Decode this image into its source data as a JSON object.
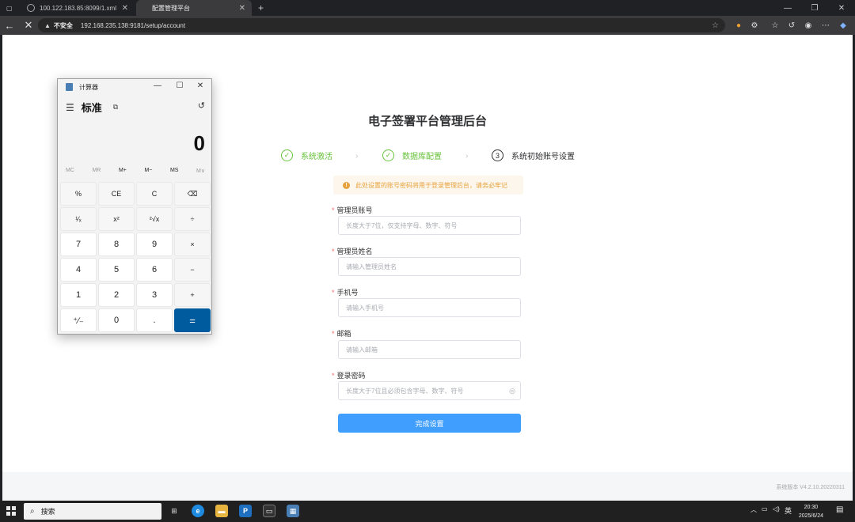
{
  "browser": {
    "tabs": [
      {
        "title": "100.122.183.85:8099/1.xml",
        "active": false
      },
      {
        "title": "配置管理平台",
        "active": true
      }
    ],
    "address": {
      "security_label": "不安全",
      "url": "192.168.235.138:9181/setup/account"
    }
  },
  "page": {
    "title": "电子签署平台管理后台",
    "steps": [
      {
        "label": "系统激活",
        "status": "done",
        "marker": "✓"
      },
      {
        "label": "数据库配置",
        "status": "done",
        "marker": "✓"
      },
      {
        "label": "系统初始账号设置",
        "status": "current",
        "marker": "3"
      }
    ],
    "alert": "此处设置的账号密码将用于登录管理后台，请务必牢记",
    "fields": [
      {
        "label": "管理员账号",
        "placeholder": "长度大于7位，仅支持字母、数字、符号",
        "required": true
      },
      {
        "label": "管理员姓名",
        "placeholder": "请输入管理员姓名",
        "required": true
      },
      {
        "label": "手机号",
        "placeholder": "请输入手机号",
        "required": true
      },
      {
        "label": "邮箱",
        "placeholder": "请输入邮箱",
        "required": true
      },
      {
        "label": "登录密码",
        "placeholder": "长度大于7位且必须包含字母、数字、符号",
        "required": true
      }
    ],
    "submit_label": "完成设置",
    "footer_version": "系统版本 V4.2.10.20220311"
  },
  "calculator": {
    "window_title": "计算器",
    "mode": "标准",
    "display": "0",
    "memory": [
      "MC",
      "MR",
      "M+",
      "M−",
      "MS",
      "M∨"
    ],
    "keys": [
      "%",
      "CE",
      "C",
      "⌫",
      "¹⁄ₓ",
      "x²",
      "²√x",
      "÷",
      "7",
      "8",
      "9",
      "×",
      "4",
      "5",
      "6",
      "−",
      "1",
      "2",
      "3",
      "+",
      "⁺∕₋",
      "0",
      ".",
      "="
    ]
  },
  "taskbar": {
    "search_label": "搜索",
    "ime": "英",
    "time": "20:30",
    "date": "2025/6/24"
  },
  "colors": {
    "primary": "#409eff",
    "success": "#67c23a",
    "warning": "#e6a23c",
    "calc_equals": "#005a9e"
  }
}
